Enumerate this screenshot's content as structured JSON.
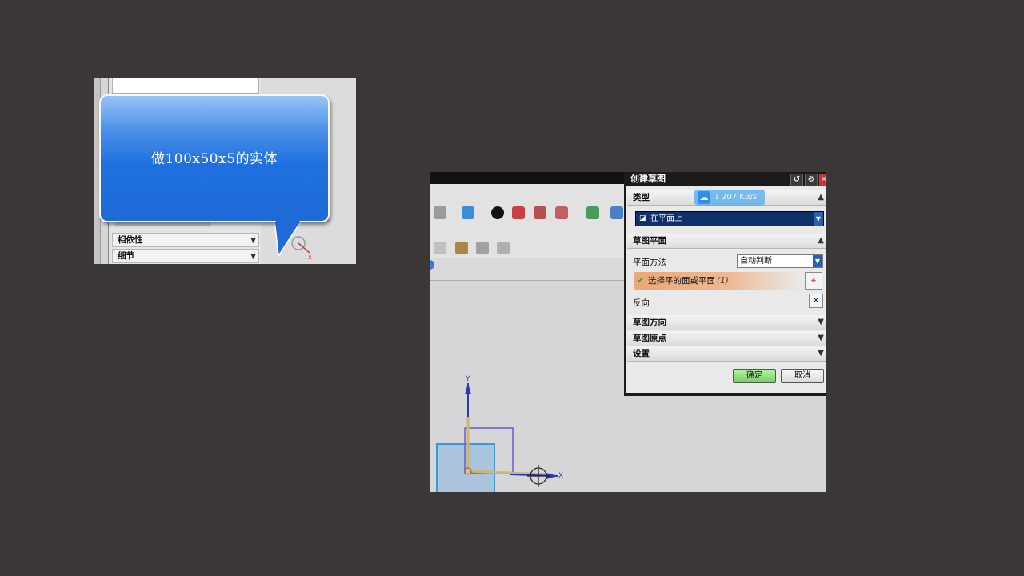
{
  "left_panel": {
    "callout_text": "做100x50x5的实体",
    "rows": [
      {
        "label": "相依性"
      },
      {
        "label": "细节"
      }
    ]
  },
  "dialog": {
    "title": "创建草图",
    "sections": {
      "type": "类型",
      "sketch_plane": "草图平面",
      "sketch_direction": "草图方向",
      "sketch_origin": "草图原点",
      "settings": "设置"
    },
    "type_value": "在平面上",
    "plane_method_label": "平面方法",
    "plane_method_value": "自动判断",
    "select_prompt": "选择平的面或平面",
    "select_count": "(1)",
    "reverse_label": "反向",
    "ok_label": "确定",
    "cancel_label": "取消"
  },
  "download_badge": {
    "speed": "207 KB/s"
  },
  "axes": {
    "y": "Y",
    "x": "X"
  },
  "colors": {
    "background": "#3a3736",
    "callout": "#1f70df",
    "ok_button": "#7edb6a",
    "select_highlight": "#e8a878"
  }
}
